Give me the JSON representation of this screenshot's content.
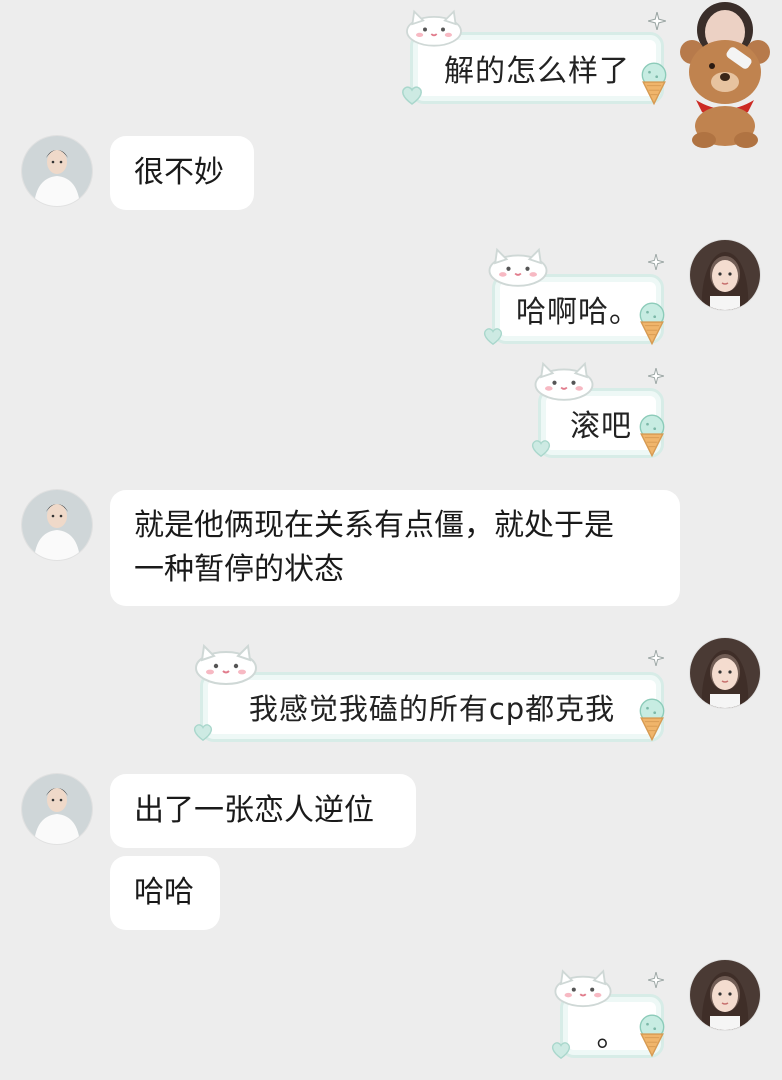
{
  "messages": [
    {
      "side": "right",
      "text": "解的怎么样了"
    },
    {
      "side": "left",
      "text": "很不妙"
    },
    {
      "side": "right",
      "text": "哈啊哈。"
    },
    {
      "side": "right",
      "text": "滚吧"
    },
    {
      "side": "left",
      "text_line1": "就是他俩现在关系有点僵，就处于是",
      "text_line2": "一种暂停的状态"
    },
    {
      "side": "right",
      "text": "我感觉我磕的所有cp都克我"
    },
    {
      "side": "left",
      "text": "出了一张恋人逆位"
    },
    {
      "side": "left",
      "text": "哈哈"
    },
    {
      "side": "right",
      "text": "。"
    }
  ],
  "avatars": {
    "left_user": "boy-avatar",
    "right_user": "girl-avatar"
  },
  "colors": {
    "background": "#ededed",
    "bubble_frame": "#d7ece7",
    "accent_mint": "#bfe6dc",
    "ice_cream_cone": "#f0b56b"
  }
}
